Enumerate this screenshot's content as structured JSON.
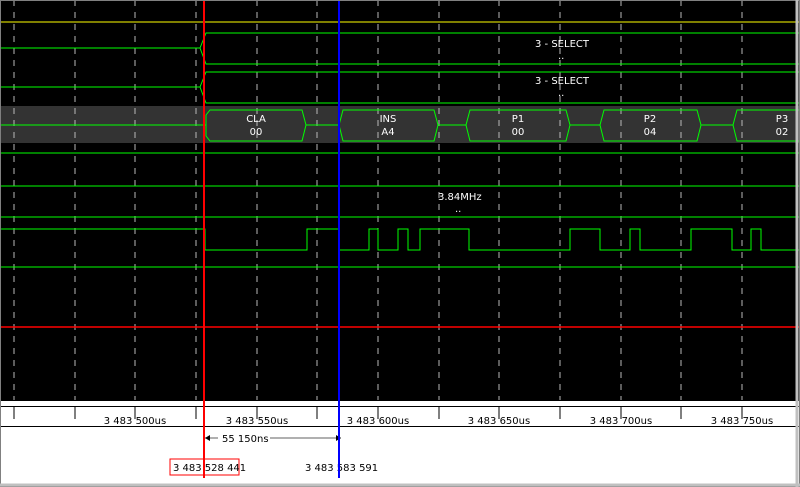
{
  "window": {
    "background": "#000000",
    "trace_color": "#00ff00",
    "grid_color": "#c8c8c8",
    "cursor1_color": "#ff0000",
    "cursor2_color": "#0000ff",
    "ruler_background": "#ffffff"
  },
  "signals": {
    "select_1": {
      "label": "3 - SELECT",
      "sub": ".."
    },
    "select_2": {
      "label": "3 - SELECT",
      "sub": ".."
    },
    "bus_fields": [
      {
        "name": "CLA",
        "value": "00"
      },
      {
        "name": "INS",
        "value": "A4"
      },
      {
        "name": "P1",
        "value": "00"
      },
      {
        "name": "P2",
        "value": "04"
      },
      {
        "name": "P3",
        "value": "02"
      }
    ],
    "clock": {
      "label": "3.84MHz",
      "sub": ".."
    }
  },
  "ruler": {
    "ticks": [
      "3 483 500us",
      "3 483 550us",
      "3 483 600us",
      "3 483 650us",
      "3 483 700us",
      "3 483 750us"
    ]
  },
  "measurement": {
    "delta_label": "55 150ns",
    "cursor1_value": "3 483 528 441",
    "cursor2_value": "3 483 583 591"
  }
}
